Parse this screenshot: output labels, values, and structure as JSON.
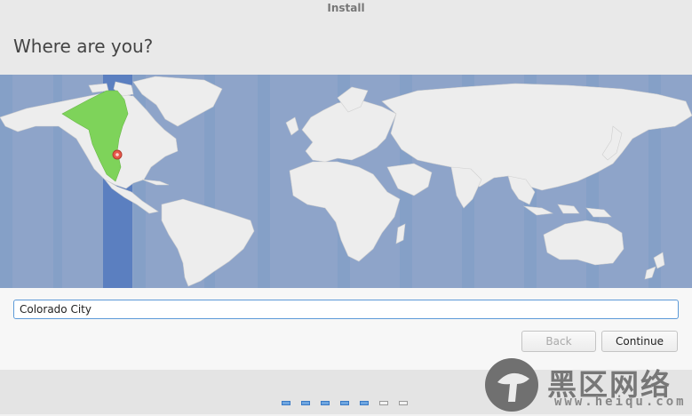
{
  "window": {
    "title": "Install"
  },
  "page": {
    "title": "Where are you?"
  },
  "map": {
    "ocean_color": "#8ea4c9",
    "land_color": "#ededed",
    "highlight_color": "#7ed35a",
    "timezone_band_color": "#5b7fc0",
    "pin_color": "#e8584a",
    "pin_icon": "location-pin-icon"
  },
  "location": {
    "value": "Colorado City",
    "placeholder": ""
  },
  "buttons": {
    "back_label": "Back",
    "continue_label": "Continue"
  },
  "progress": {
    "total_steps": 7,
    "completed_steps": 5
  },
  "watermark": {
    "text": "黑区网络",
    "url": "www.heiqu.com"
  }
}
